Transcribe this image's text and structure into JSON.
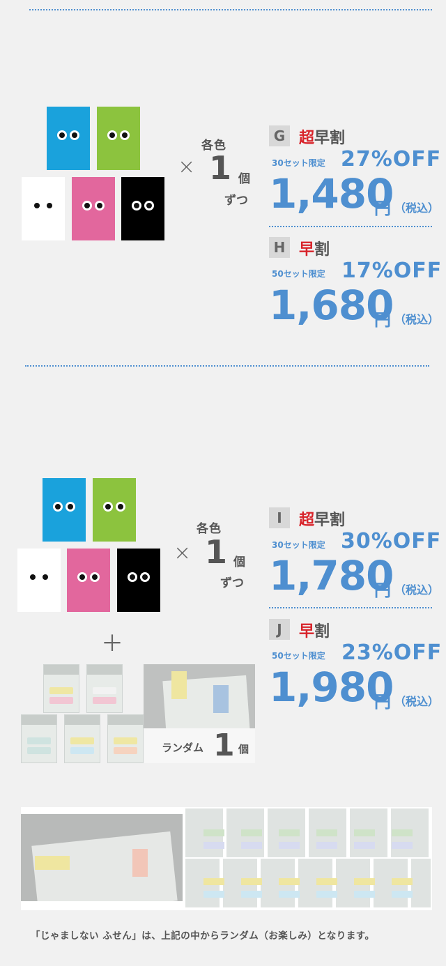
{
  "set_gh": {
    "times": "×",
    "each_color": "各色",
    "qty": "1",
    "unit": "個",
    "zutsu": "ずつ",
    "offers": [
      {
        "letter": "G",
        "label_red": "超",
        "label_rest": "早割",
        "limit": "30セット限定",
        "discount": "27%OFF",
        "price": "1,480",
        "yen": "円",
        "tax": "（税込）"
      },
      {
        "letter": "H",
        "label_red": "早",
        "label_rest": "割",
        "limit": "50セット限定",
        "discount": "17%OFF",
        "price": "1,680",
        "yen": "円",
        "tax": "（税込）"
      }
    ]
  },
  "set_ij": {
    "times": "×",
    "each_color": "各色",
    "qty": "1",
    "unit": "個",
    "zutsu": "ずつ",
    "plus": "＋",
    "random_text": "ランダム",
    "random_qty": "1",
    "random_unit": "個",
    "offers": [
      {
        "letter": "I",
        "label_red": "超",
        "label_rest": "早割",
        "limit": "30セット限定",
        "discount": "30%OFF",
        "price": "1,780",
        "yen": "円",
        "tax": "（税込）"
      },
      {
        "letter": "J",
        "label_red": "早",
        "label_rest": "割",
        "limit": "50セット限定",
        "discount": "23%OFF",
        "price": "1,980",
        "yen": "円",
        "tax": "（税込）"
      }
    ]
  },
  "footnote": "「じゃましない ふせん」は、上記の中からランダム（お楽しみ）となります。",
  "colors": {
    "blue": "#1aa2dc",
    "green": "#8cc33e",
    "white": "#ffffff",
    "pink": "#e2679d",
    "black": "#000000",
    "accent": "#4e8fd0",
    "red": "#d8232a"
  }
}
